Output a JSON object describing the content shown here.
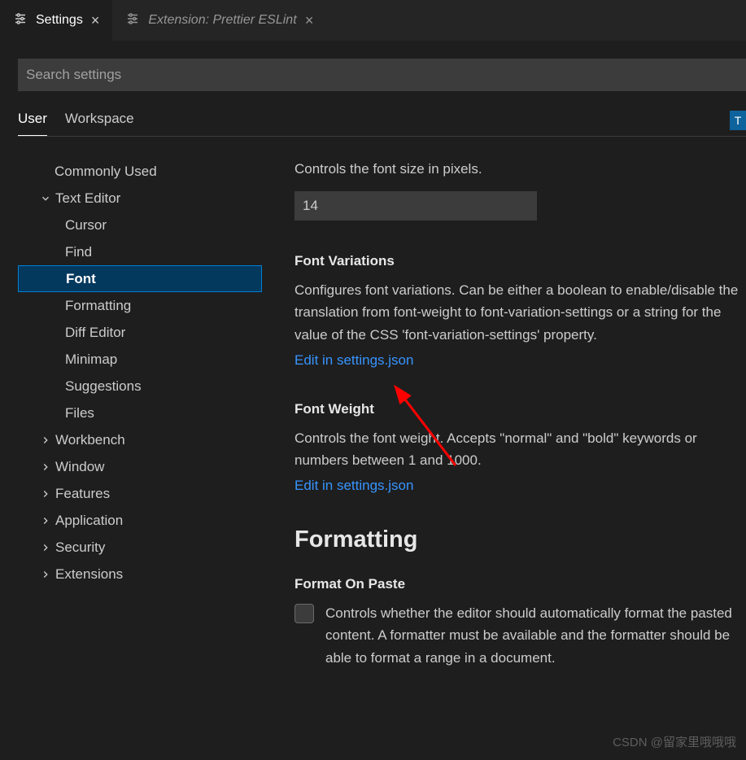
{
  "tabs": {
    "settings": "Settings",
    "extension": "Extension: Prettier ESLint"
  },
  "search": {
    "placeholder": "Search settings"
  },
  "scope": {
    "user": "User",
    "workspace": "Workspace",
    "badge": "T"
  },
  "tree": {
    "commonly_used": "Commonly Used",
    "text_editor": "Text Editor",
    "cursor": "Cursor",
    "find": "Find",
    "font": "Font",
    "formatting": "Formatting",
    "diff_editor": "Diff Editor",
    "minimap": "Minimap",
    "suggestions": "Suggestions",
    "files": "Files",
    "workbench": "Workbench",
    "window": "Window",
    "features": "Features",
    "application": "Application",
    "security": "Security",
    "extensions": "Extensions"
  },
  "settings": {
    "font_size_desc": "Controls the font size in pixels.",
    "font_size_value": "14",
    "font_variations_title": "Font Variations",
    "font_variations_desc": "Configures font variations. Can be either a boolean to enable/disable the translation from font-weight to font-variation-settings or a string for the value of the CSS 'font-variation-settings' property.",
    "edit_link": "Edit in settings.json",
    "font_weight_title": "Font Weight",
    "font_weight_desc": "Controls the font weight. Accepts \"normal\" and \"bold\" keywords or numbers between 1 and 1000.",
    "formatting_heading": "Formatting",
    "format_on_paste_title": "Format On Paste",
    "format_on_paste_desc": "Controls whether the editor should automatically format the pasted content. A formatter must be available and the formatter should be able to format a range in a document."
  },
  "watermark": "CSDN @留家里哦哦哦"
}
